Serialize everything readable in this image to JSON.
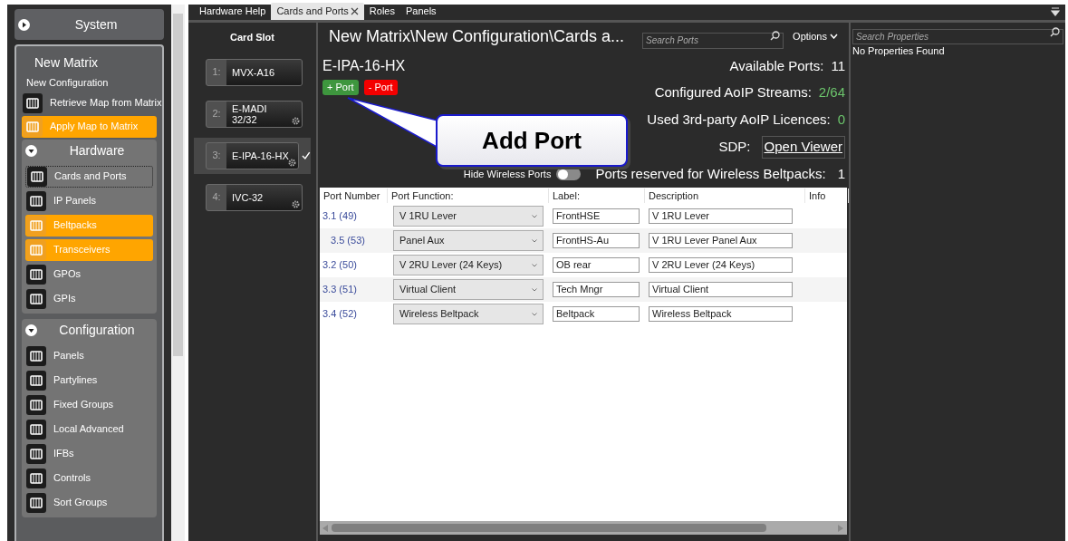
{
  "sidebar": {
    "system": {
      "label": "System",
      "expanded": false
    },
    "matrix": {
      "title": "New Matrix",
      "subtitle": "New Configuration"
    },
    "actions": [
      {
        "label": "Retrieve Map from Matrix",
        "highlighted": false
      },
      {
        "label": "Apply Map to Matrix",
        "highlighted": true
      }
    ],
    "sections": [
      {
        "label": "Hardware",
        "expanded": true,
        "items": [
          {
            "label": "Cards and Ports",
            "highlighted": false,
            "selected": true
          },
          {
            "label": "IP Panels",
            "highlighted": false,
            "selected": false
          },
          {
            "label": "Beltpacks",
            "highlighted": true,
            "selected": false
          },
          {
            "label": "Transceivers",
            "highlighted": true,
            "selected": false
          },
          {
            "label": "GPOs",
            "highlighted": false,
            "selected": false
          },
          {
            "label": "GPIs",
            "highlighted": false,
            "selected": false
          }
        ]
      },
      {
        "label": "Configuration",
        "expanded": true,
        "items": [
          {
            "label": "Panels",
            "highlighted": false,
            "selected": false
          },
          {
            "label": "Partylines",
            "highlighted": false,
            "selected": false
          },
          {
            "label": "Fixed Groups",
            "highlighted": false,
            "selected": false
          },
          {
            "label": "Local Advanced",
            "highlighted": false,
            "selected": false
          },
          {
            "label": "IFBs",
            "highlighted": false,
            "selected": false
          },
          {
            "label": "Controls",
            "highlighted": false,
            "selected": false
          },
          {
            "label": "Sort Groups",
            "highlighted": false,
            "selected": false
          }
        ]
      }
    ]
  },
  "tabs": [
    {
      "label": "Hardware Help",
      "selected": false,
      "closable": false
    },
    {
      "label": "Cards and Ports",
      "selected": true,
      "closable": true
    },
    {
      "label": "Roles",
      "selected": false,
      "closable": false
    },
    {
      "label": "Panels",
      "selected": false,
      "closable": false
    }
  ],
  "card_slots": {
    "title": "Card Slot",
    "cards": [
      {
        "number": "1:",
        "name": "MVX-A16",
        "settings": false,
        "selected": false
      },
      {
        "number": "2:",
        "name": "E-MADI 32/32",
        "settings": true,
        "selected": false
      },
      {
        "number": "3:",
        "name": "E-IPA-16-HX",
        "settings": true,
        "selected": true
      },
      {
        "number": "4:",
        "name": "IVC-32",
        "settings": true,
        "selected": false
      }
    ]
  },
  "main": {
    "breadcrumb": "New Matrix\\New Configuration\\Cards a...",
    "search": {
      "placeholder": "Search Ports"
    },
    "options": "Options",
    "card_name": "E-IPA-16-HX",
    "add_button": "+ Port",
    "remove_button": "- Port",
    "stats": [
      {
        "label": "Available Ports:",
        "value": "11",
        "highlight": false
      },
      {
        "label": "Configured AoIP Streams:",
        "value": "2/64",
        "highlight": true
      },
      {
        "label": "Used 3rd-party AoIP Licences:",
        "value": "0",
        "highlight": true
      }
    ],
    "sdp": {
      "label": "SDP:",
      "link": "Open Viewer"
    },
    "hide_wireless": {
      "label": "Hide Wireless Ports",
      "on": false
    },
    "reserved": {
      "label": "Ports reserved for Wireless Beltpacks:",
      "value": "1"
    },
    "callout": "Add Port"
  },
  "table": {
    "columns": [
      "Port Number",
      "Port Function:",
      "Label:",
      "Description",
      "Info"
    ],
    "rows": [
      {
        "port": "3.1 (49)",
        "function": "V 1RU Lever",
        "label": "FrontHSE",
        "description": "V 1RU Lever",
        "children": [
          {
            "port": "3.5 (53)",
            "function": "Panel Aux",
            "label": "FrontHS-Au",
            "description": "V 1RU Lever Panel Aux"
          }
        ]
      },
      {
        "port": "3.2 (50)",
        "function": "V 2RU Lever (24 Keys)",
        "label": "OB rear",
        "description": "V 2RU Lever (24 Keys)"
      },
      {
        "port": "3.3 (51)",
        "function": "Virtual Client",
        "label": "Tech Mngr",
        "description": "Virtual Client"
      },
      {
        "port": "3.4 (52)",
        "function": "Wireless Beltpack",
        "label": "Beltpack",
        "description": "Wireless Beltpack"
      }
    ]
  },
  "properties": {
    "search": {
      "placeholder": "Search Properties"
    },
    "message": "No Properties Found"
  }
}
